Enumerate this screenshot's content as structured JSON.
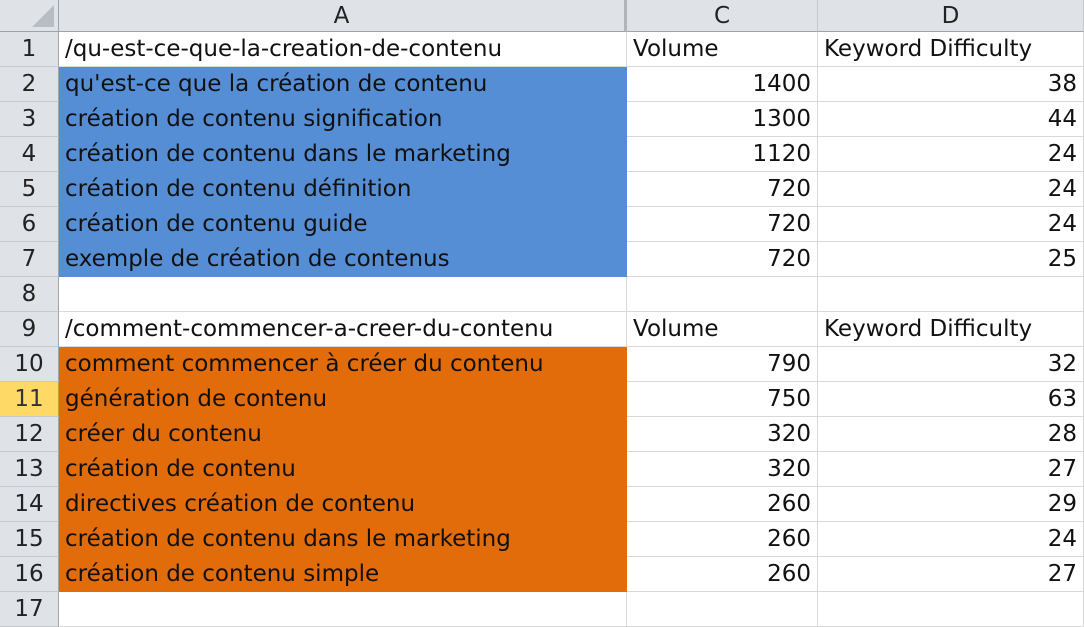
{
  "columns": [
    "A",
    "C",
    "D"
  ],
  "active_row": 11,
  "colors": {
    "block1_fill": "#558ed5",
    "block2_fill": "#e26b0a",
    "active_row_header": "#ffd966"
  },
  "rows": [
    {
      "num": "1",
      "a": "/qu-est-ce-que-la-creation-de-contenu",
      "c": "Volume",
      "d": "Keyword Difficulty",
      "fill": "",
      "type": "header"
    },
    {
      "num": "2",
      "a": "qu'est-ce que la création de contenu",
      "c": "1400",
      "d": "38",
      "fill": "blue",
      "type": "data"
    },
    {
      "num": "3",
      "a": "création de contenu signification",
      "c": "1300",
      "d": "44",
      "fill": "blue",
      "type": "data"
    },
    {
      "num": "4",
      "a": "création de contenu dans le marketing",
      "c": "1120",
      "d": "24",
      "fill": "blue",
      "type": "data"
    },
    {
      "num": "5",
      "a": "création de contenu définition",
      "c": "720",
      "d": "24",
      "fill": "blue",
      "type": "data"
    },
    {
      "num": "6",
      "a": "création de contenu guide",
      "c": "720",
      "d": "24",
      "fill": "blue",
      "type": "data"
    },
    {
      "num": "7",
      "a": "exemple de création de contenus",
      "c": "720",
      "d": "25",
      "fill": "blue",
      "type": "data"
    },
    {
      "num": "8",
      "a": "",
      "c": "",
      "d": "",
      "fill": "",
      "type": "empty"
    },
    {
      "num": "9",
      "a": "/comment-commencer-a-creer-du-contenu",
      "c": "Volume",
      "d": "Keyword Difficulty",
      "fill": "",
      "type": "header"
    },
    {
      "num": "10",
      "a": "comment commencer à créer du contenu",
      "c": "790",
      "d": "32",
      "fill": "orange",
      "type": "data"
    },
    {
      "num": "11",
      "a": "génération de contenu",
      "c": "750",
      "d": "63",
      "fill": "orange",
      "type": "data"
    },
    {
      "num": "12",
      "a": "créer du contenu",
      "c": "320",
      "d": "28",
      "fill": "orange",
      "type": "data"
    },
    {
      "num": "13",
      "a": "création de contenu",
      "c": "320",
      "d": "27",
      "fill": "orange",
      "type": "data"
    },
    {
      "num": "14",
      "a": "directives création de contenu",
      "c": "260",
      "d": "29",
      "fill": "orange",
      "type": "data"
    },
    {
      "num": "15",
      "a": "création de contenu dans le marketing",
      "c": "260",
      "d": "24",
      "fill": "orange",
      "type": "data"
    },
    {
      "num": "16",
      "a": "création de contenu simple",
      "c": "260",
      "d": "27",
      "fill": "orange",
      "type": "data"
    },
    {
      "num": "17",
      "a": "",
      "c": "",
      "d": "",
      "fill": "",
      "type": "empty"
    }
  ]
}
